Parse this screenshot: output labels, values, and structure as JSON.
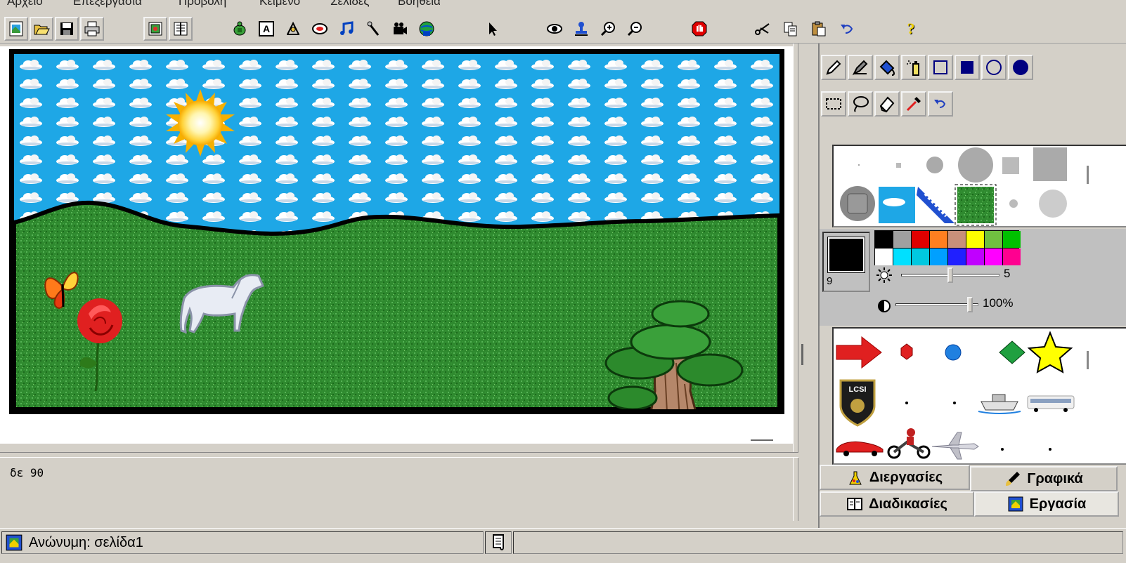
{
  "menu": {
    "items": [
      "Αρχείο",
      "Επεξεργασία",
      "Προβολή",
      "Κείμενο",
      "Σελίδες",
      "Βοήθεια"
    ]
  },
  "toolbar": {
    "buttons": [
      "new-page",
      "open",
      "save",
      "print",
      "show-shapes",
      "show-procedures",
      "new-turtle",
      "new-textbox",
      "new-slider",
      "new-button",
      "new-music",
      "new-sound",
      "new-video",
      "new-web",
      "pointer",
      "look",
      "stamp",
      "zoom-in",
      "zoom-out",
      "stop",
      "cut",
      "copy",
      "paste",
      "undo",
      "help"
    ]
  },
  "command_center": {
    "text": "δε 90"
  },
  "paint": {
    "pen_size": "9",
    "brightness_value": "5",
    "opacity_value": "100%",
    "palette_row1": [
      "#000000",
      "#a0a0a0",
      "#e00000",
      "#ff7f20",
      "#c8907a",
      "#ffff00",
      "#70c040",
      "#00c000"
    ],
    "palette_row2": [
      "#ffffff",
      "#00e0ff",
      "#00c8e0",
      "#00a0ff",
      "#2020ff",
      "#c000ff",
      "#ff00ff",
      "#ff0090"
    ]
  },
  "tabs": {
    "processes": "Διεργασίες",
    "graphics": "Γραφικά",
    "procedures": "Διαδικασίες",
    "project": "Εργασία"
  },
  "status": {
    "text": "Ανώνυμη:  σελίδα1"
  },
  "colors": {
    "sky": "#1ea7e6",
    "grass": "#2e8b2e",
    "chrome": "#d4d0c8"
  }
}
